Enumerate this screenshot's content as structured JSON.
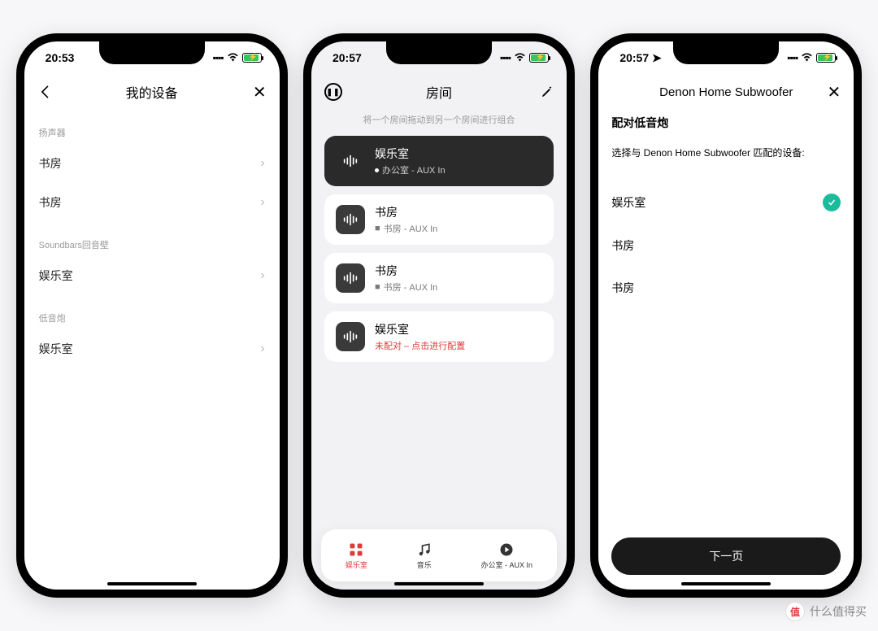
{
  "watermark": "什么值得买",
  "screen1": {
    "time": "20:53",
    "title": "我的设备",
    "sections": [
      {
        "header": "扬声器",
        "items": [
          "书房",
          "书房"
        ]
      },
      {
        "header": "Soundbars回音壁",
        "items": [
          "娱乐室"
        ]
      },
      {
        "header": "低音炮",
        "items": [
          "娱乐室"
        ]
      }
    ]
  },
  "screen2": {
    "time": "20:57",
    "title": "房间",
    "hint": "将一个房间拖动到另一个房间进行组合",
    "rooms": [
      {
        "title": "娱乐室",
        "sub": "办公室 - AUX In",
        "dark": true,
        "showDot": true
      },
      {
        "title": "书房",
        "sub": "书房 - AUX In",
        "dark": false
      },
      {
        "title": "书房",
        "sub": "书房 - AUX In",
        "dark": false
      },
      {
        "title": "娱乐室",
        "sub": "未配对 – 点击进行配置",
        "dark": false,
        "red": true
      }
    ],
    "tabs": {
      "rooms": "娱乐室",
      "music": "音乐",
      "now": "办公室 - AUX In"
    }
  },
  "screen3": {
    "time": "20:57",
    "title": "Denon Home Subwoofer",
    "heading": "配对低音炮",
    "subtitle": "选择与 Denon Home Subwoofer 匹配的设备:",
    "options": [
      {
        "label": "娱乐室",
        "selected": true
      },
      {
        "label": "书房",
        "selected": false
      },
      {
        "label": "书房",
        "selected": false
      }
    ],
    "next": "下一页"
  }
}
